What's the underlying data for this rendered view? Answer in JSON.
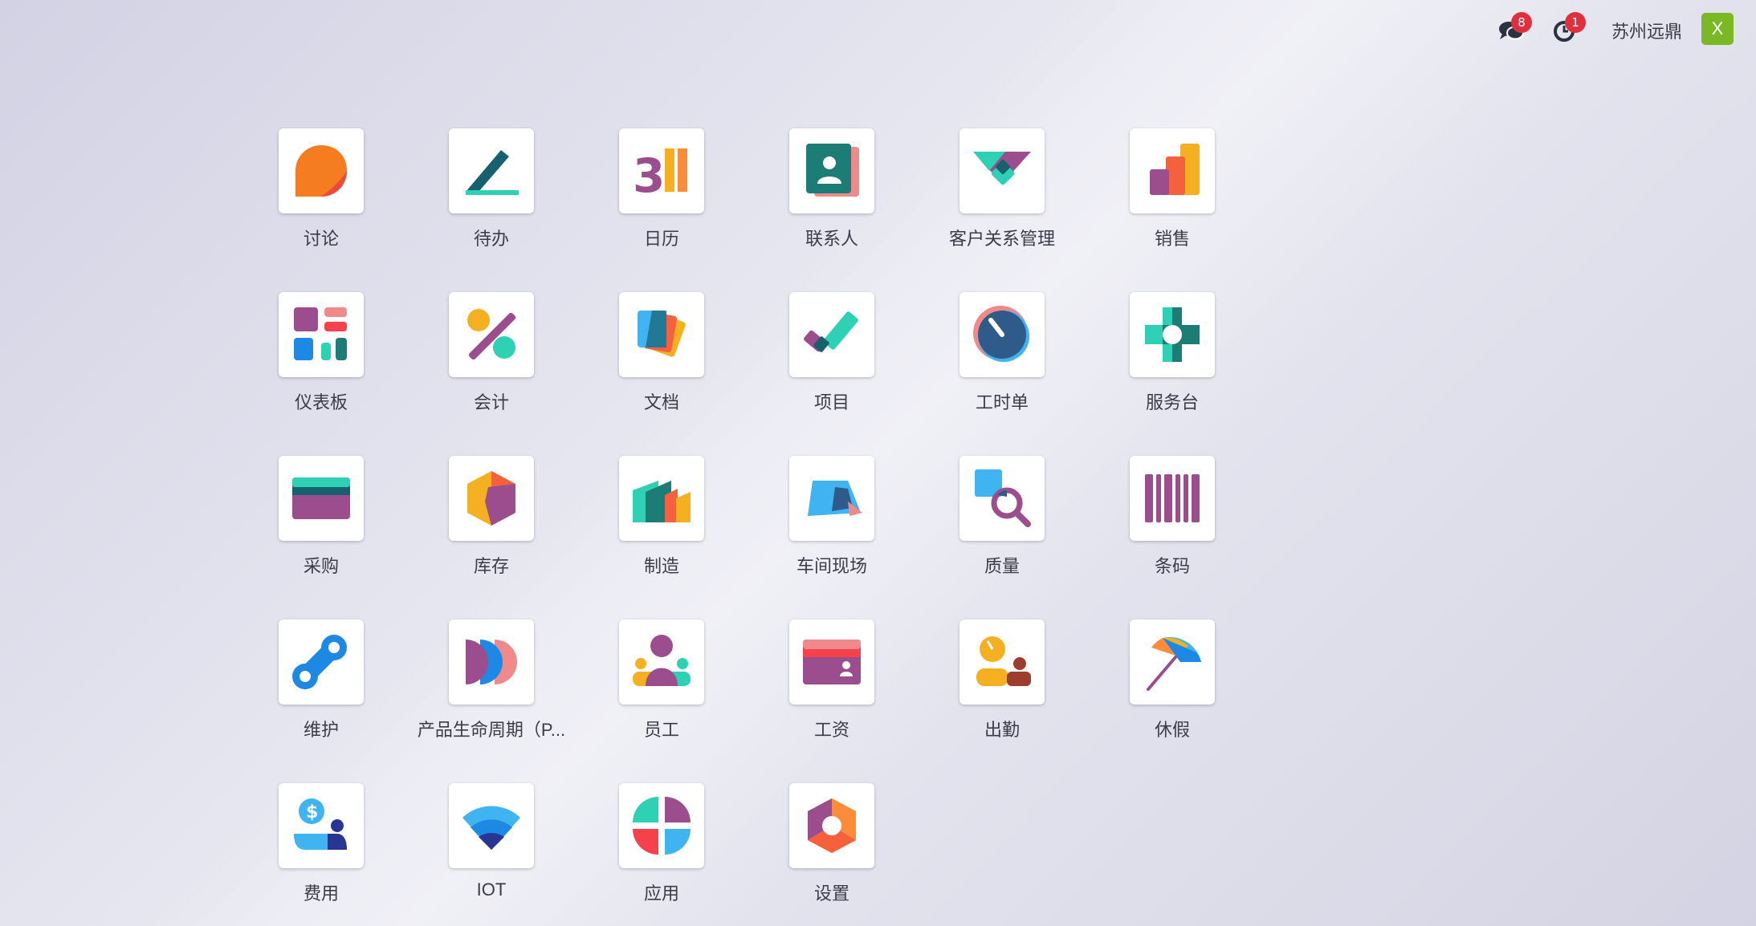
{
  "topbar": {
    "messages_badge": "8",
    "activities_badge": "1",
    "company_name": "苏州远鼎",
    "user_initial": "X"
  },
  "apps": [
    {
      "label": "讨论",
      "icon": "discuss-icon"
    },
    {
      "label": "待办",
      "icon": "todo-icon"
    },
    {
      "label": "日历",
      "icon": "calendar-icon"
    },
    {
      "label": "联系人",
      "icon": "contacts-icon"
    },
    {
      "label": "客户关系管理",
      "icon": "crm-icon"
    },
    {
      "label": "销售",
      "icon": "sales-icon"
    },
    {
      "label": "仪表板",
      "icon": "dashboard-icon"
    },
    {
      "label": "会计",
      "icon": "accounting-icon"
    },
    {
      "label": "文档",
      "icon": "documents-icon"
    },
    {
      "label": "项目",
      "icon": "project-icon"
    },
    {
      "label": "工时单",
      "icon": "timesheet-icon"
    },
    {
      "label": "服务台",
      "icon": "helpdesk-icon"
    },
    {
      "label": "采购",
      "icon": "purchase-icon"
    },
    {
      "label": "库存",
      "icon": "inventory-icon"
    },
    {
      "label": "制造",
      "icon": "manufacturing-icon"
    },
    {
      "label": "车间现场",
      "icon": "shopfloor-icon"
    },
    {
      "label": "质量",
      "icon": "quality-icon"
    },
    {
      "label": "条码",
      "icon": "barcode-icon"
    },
    {
      "label": "维护",
      "icon": "maintenance-icon"
    },
    {
      "label": "产品生命周期（P...",
      "icon": "plm-icon"
    },
    {
      "label": "员工",
      "icon": "employees-icon"
    },
    {
      "label": "工资",
      "icon": "payroll-icon"
    },
    {
      "label": "出勤",
      "icon": "attendance-icon"
    },
    {
      "label": "休假",
      "icon": "timeoff-icon"
    },
    {
      "label": "费用",
      "icon": "expenses-icon"
    },
    {
      "label": "IOT",
      "icon": "iot-icon"
    },
    {
      "label": "应用",
      "icon": "apps-icon"
    },
    {
      "label": "设置",
      "icon": "settings-icon"
    }
  ]
}
